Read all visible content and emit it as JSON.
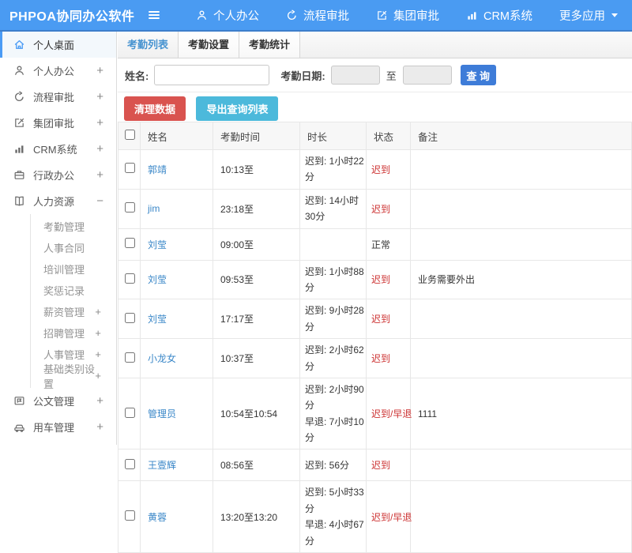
{
  "app": {
    "title": "PHPOA协同办公软件"
  },
  "topnav": {
    "items": [
      {
        "id": "personal-office",
        "label": "个人办公",
        "icon": "user"
      },
      {
        "id": "workflow-approval",
        "label": "流程审批",
        "icon": "process"
      },
      {
        "id": "group-approval",
        "label": "集团审批",
        "icon": "edit"
      },
      {
        "id": "crm-system",
        "label": "CRM系统",
        "icon": "chart"
      },
      {
        "id": "more-apps",
        "label": "更多应用",
        "caret": true
      }
    ]
  },
  "sidebar": {
    "items": [
      {
        "id": "personal-desktop",
        "label": "个人桌面",
        "icon": "home",
        "active": true,
        "expand": ""
      },
      {
        "id": "personal-office",
        "label": "个人办公",
        "icon": "user",
        "expand": "+"
      },
      {
        "id": "workflow-approval",
        "label": "流程审批",
        "icon": "process",
        "expand": "+"
      },
      {
        "id": "group-approval",
        "label": "集团审批",
        "icon": "edit",
        "expand": "+"
      },
      {
        "id": "crm-system",
        "label": "CRM系统",
        "icon": "chart",
        "expand": "+"
      },
      {
        "id": "admin-office",
        "label": "行政办公",
        "icon": "briefcase",
        "expand": "+"
      },
      {
        "id": "human-resources",
        "label": "人力资源",
        "icon": "book",
        "expand": "−",
        "children": [
          {
            "id": "attendance-mgmt",
            "label": "考勤管理",
            "expand": ""
          },
          {
            "id": "hr-contract",
            "label": "人事合同",
            "expand": ""
          },
          {
            "id": "training-mgmt",
            "label": "培训管理",
            "expand": ""
          },
          {
            "id": "reward-record",
            "label": "奖惩记录",
            "expand": ""
          },
          {
            "id": "salary-mgmt",
            "label": "薪资管理",
            "expand": "+"
          },
          {
            "id": "recruit-mgmt",
            "label": "招聘管理",
            "expand": "+"
          },
          {
            "id": "personnel-mgmt",
            "label": "人事管理",
            "expand": "+"
          },
          {
            "id": "base-category",
            "label": "基础类别设置",
            "expand": "+"
          }
        ]
      },
      {
        "id": "document-mgmt",
        "label": "公文管理",
        "icon": "doc",
        "expand": "+"
      },
      {
        "id": "vehicle-mgmt",
        "label": "用车管理",
        "icon": "car",
        "expand": "+"
      }
    ]
  },
  "tabs": [
    {
      "id": "attendance-list",
      "label": "考勤列表",
      "active": true
    },
    {
      "id": "attendance-settings",
      "label": "考勤设置",
      "active": false
    },
    {
      "id": "attendance-stats",
      "label": "考勤统计",
      "active": false
    }
  ],
  "filter": {
    "name_label": "姓名:",
    "name_value": "",
    "date_label": "考勤日期:",
    "date_from_value": "",
    "to_label": "至",
    "date_to_value": "",
    "search_label": "查 询"
  },
  "actions": {
    "clear_label": "清理数据",
    "export_label": "导出查询列表"
  },
  "table": {
    "columns": [
      "姓名",
      "考勤时间",
      "时长",
      "状态",
      "备注"
    ],
    "rows": [
      {
        "name": "郭靖",
        "time": "10:13至",
        "duration": "迟到: 1小时22分",
        "status": "迟到",
        "status_color": "red",
        "remark": ""
      },
      {
        "name": "jim",
        "time": "23:18至",
        "duration": "迟到: 14小时30分",
        "status": "迟到",
        "status_color": "red",
        "remark": ""
      },
      {
        "name": "刘莹",
        "time": "09:00至",
        "duration": "",
        "status": "正常",
        "status_color": "normal",
        "remark": ""
      },
      {
        "name": "刘莹",
        "time": "09:53至",
        "duration": "迟到: 1小时88分",
        "status": "迟到",
        "status_color": "red",
        "remark": "业务需要外出"
      },
      {
        "name": "刘莹",
        "time": "17:17至",
        "duration": "迟到: 9小时28分",
        "status": "迟到",
        "status_color": "red",
        "remark": ""
      },
      {
        "name": "小龙女",
        "time": "10:37至",
        "duration": "迟到: 2小时62分",
        "status": "迟到",
        "status_color": "red",
        "remark": ""
      },
      {
        "name": "管理员",
        "time": "10:54至10:54",
        "duration": "迟到: 2小时90分\n早退: 7小时10分",
        "status": "迟到/早退",
        "status_color": "red",
        "remark": "1111"
      },
      {
        "name": "王壹辉",
        "time": "08:56至",
        "duration": "迟到: 56分",
        "status": "迟到",
        "status_color": "red",
        "remark": ""
      },
      {
        "name": "黄蓉",
        "time": "13:20至13:20",
        "duration": "迟到: 5小时33分\n早退: 4小时67分",
        "status": "迟到/早退",
        "status_color": "red",
        "remark": ""
      }
    ]
  },
  "colors": {
    "topbar": "#4a9bf2",
    "topbar-border": "#3d7ecb",
    "sidebar-active": "#4a9bf5",
    "tab-active": "#4793d0",
    "primary": "#3e7cd8",
    "danger": "#d9534f",
    "info": "#4cb9db",
    "link": "#3a87c8",
    "status-red": "#cc3030"
  }
}
